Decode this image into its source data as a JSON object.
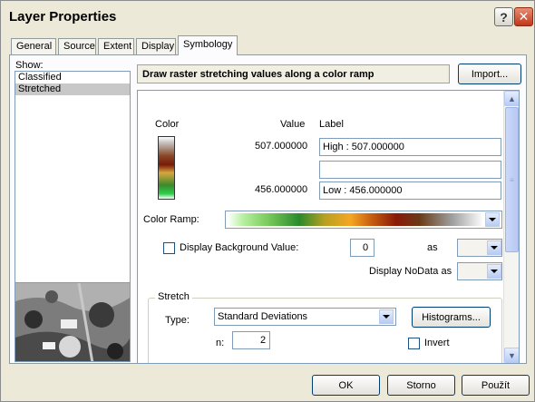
{
  "window": {
    "title": "Layer Properties"
  },
  "tabs": [
    {
      "label": "General"
    },
    {
      "label": "Source"
    },
    {
      "label": "Extent"
    },
    {
      "label": "Display"
    },
    {
      "label": "Symbology",
      "active": true
    }
  ],
  "show": {
    "label": "Show:",
    "items": [
      {
        "label": "Classified",
        "selected": false
      },
      {
        "label": "Stretched",
        "selected": true
      }
    ]
  },
  "symbology": {
    "description": "Draw raster stretching values along a color ramp",
    "import_label": "Import...",
    "headers": {
      "color": "Color",
      "value": "Value",
      "label": "Label"
    },
    "high_value": "507.000000",
    "high_label": "High : 507.000000",
    "middle_label": "",
    "low_value": "456.000000",
    "low_label": "Low : 456.000000",
    "color_ramp_label": "Color Ramp:",
    "display_background_label": "Display Background Value:",
    "display_background_checked": false,
    "background_value": "0",
    "as_label": "as",
    "display_nodata_label": "Display NoData as",
    "stretch": {
      "group_title": "Stretch",
      "type_label": "Type:",
      "type_value": "Standard Deviations",
      "histograms_label": "Histograms...",
      "n_label": "n:",
      "n_value": "2",
      "invert_label": "Invert",
      "invert_checked": false
    }
  },
  "buttons": {
    "ok": "OK",
    "cancel": "Storno",
    "apply": "Použít"
  },
  "icons": {
    "help": "help-icon",
    "close": "close-icon"
  }
}
